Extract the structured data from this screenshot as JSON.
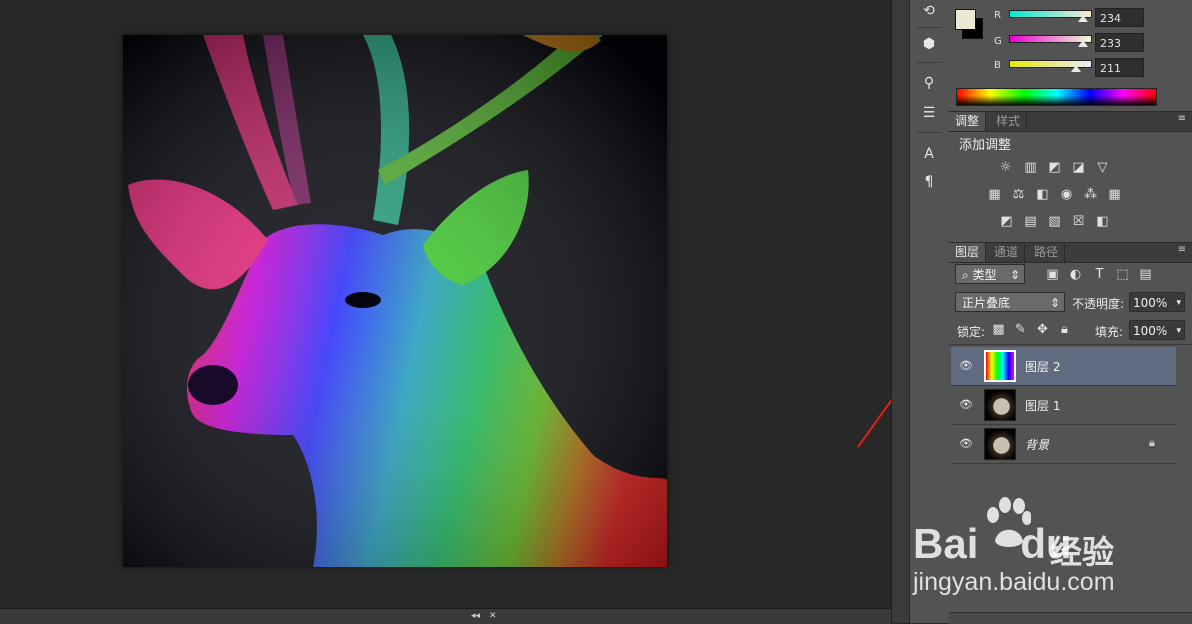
{
  "canvas": {
    "bottom_controls": [
      "◂◂",
      "✕"
    ]
  },
  "tools": [
    "3d-rotate-icon",
    "3d-object-icon",
    "brush-presets-icon",
    "adjust-sliders-icon",
    "character-icon",
    "paragraph-icon"
  ],
  "color_panel": {
    "foreground_color": "#EAE9D3",
    "background_color": "#000000",
    "channels": [
      {
        "label": "R",
        "value": "234",
        "fraction": 0.918
      },
      {
        "label": "G",
        "value": "233",
        "fraction": 0.914
      },
      {
        "label": "B",
        "value": "211",
        "fraction": 0.827
      }
    ]
  },
  "adjustments_panel": {
    "tabs": [
      "调整",
      "样式"
    ],
    "heading": "添加调整"
  },
  "layers_panel": {
    "tabs": [
      "图层",
      "通道",
      "路径"
    ],
    "filter_kind": "类型",
    "blend_mode": "正片叠底",
    "opacity_label": "不透明度:",
    "opacity_value": "100%",
    "lock_label": "锁定:",
    "fill_label": "填充:",
    "fill_value": "100%",
    "layers": [
      {
        "name": "图层 2",
        "selected": true
      },
      {
        "name": "图层 1",
        "selected": false
      },
      {
        "name": "背景",
        "selected": false,
        "locked": true
      }
    ]
  },
  "watermark": {
    "brand": "Bai",
    "brand_suffix": "du",
    "product": "经验",
    "url": "jingyan.baidu.com"
  },
  "annotation": {
    "color": "#E0201A"
  }
}
